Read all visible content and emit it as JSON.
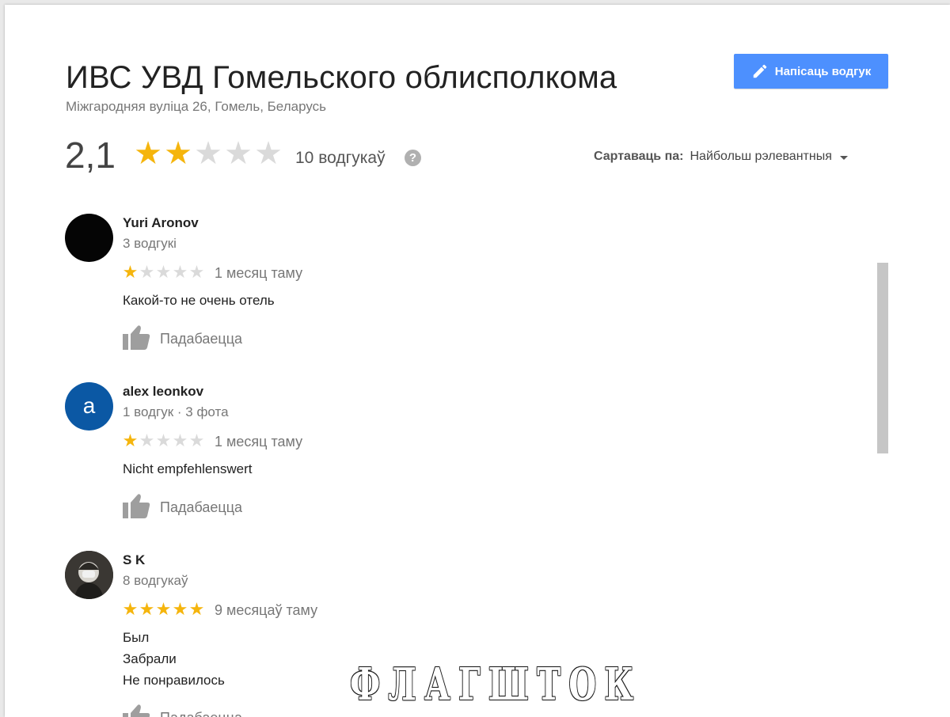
{
  "place": {
    "title": "ИВС УВД Гомельского облисполкома",
    "address": "Міжгародняя вуліца 26, Гомель, Беларусь"
  },
  "write_review_label": "Напісаць водгук",
  "summary": {
    "rating": "2,1",
    "rating_value": 2.1,
    "stars_filled": 2,
    "stars_total": 5,
    "review_count": "10 водгукаў",
    "help_icon": "?"
  },
  "sort": {
    "label": "Сартаваць па:",
    "value": "Найбольш рэлевантныя"
  },
  "colors": {
    "accent": "#4d90fe",
    "star_on": "#f5b50d",
    "star_off": "#dadada",
    "avatar_letter_bg": "#0b58a4"
  },
  "reviews": [
    {
      "name": "Yuri Aronov",
      "meta": "3 водгукі",
      "avatar": "black-avatar",
      "stars": 1,
      "time": "1 месяц таму",
      "text": [
        "Какой-то не очень отель"
      ],
      "like_label": "Падабаецца"
    },
    {
      "name": "alex leonkov",
      "meta": "1 водгук · 3 фота",
      "avatar_letter": "a",
      "stars": 1,
      "time": "1 месяц таму",
      "text": [
        "Nicht empfehlenswert"
      ],
      "like_label": "Падабаецца"
    },
    {
      "name": "S K",
      "meta": "8 водгукаў",
      "avatar": "photo-avatar",
      "stars": 5,
      "time": "9 месяцаў таму",
      "text": [
        "Был",
        "Забрали",
        "Не понравилось"
      ],
      "like_label": "Падабаецца"
    }
  ],
  "watermark": "ФЛАГШТОК"
}
